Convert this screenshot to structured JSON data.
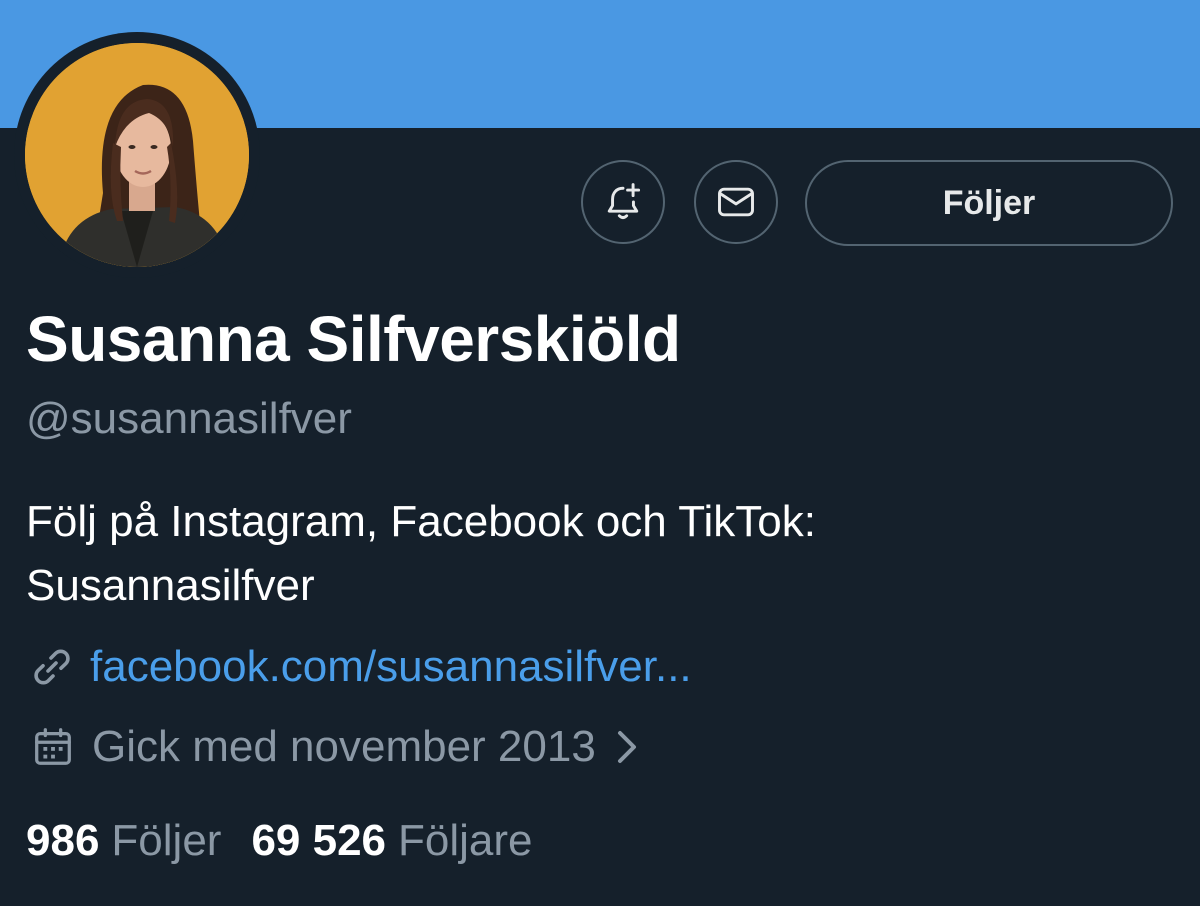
{
  "colors": {
    "background": "#15202b",
    "banner": "#4a98e3",
    "border": "#536471",
    "muted_text": "#8b98a5",
    "link": "#4a9eea",
    "avatar_bg": "#e1a232"
  },
  "profile": {
    "display_name": "Susanna Silfverskiöld",
    "handle": "@susannasilfver",
    "bio_lines": [
      "Följ på Instagram, Facebook och TikTok:",
      "Susannasilfver"
    ],
    "link": {
      "icon": "link-icon",
      "text": "facebook.com/susannasilfver..."
    },
    "joined": {
      "icon": "calendar-icon",
      "text": "Gick med november 2013"
    }
  },
  "actions": {
    "notify_icon": "bell-plus-icon",
    "message_icon": "envelope-icon",
    "follow_label": "Följer"
  },
  "stats": {
    "following_count": "986",
    "following_label": "Följer",
    "followers_count": "69 526",
    "followers_label": "Följare"
  }
}
